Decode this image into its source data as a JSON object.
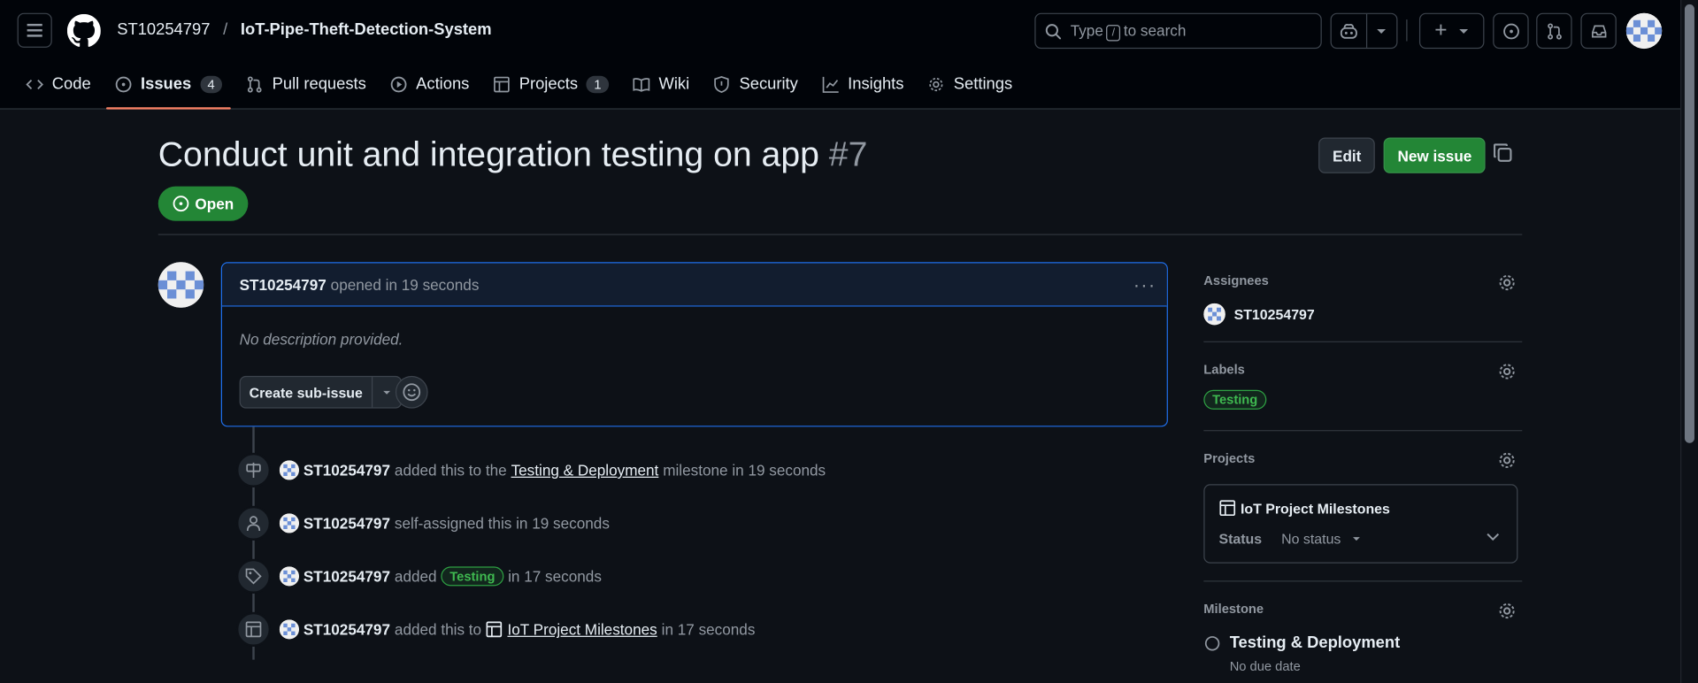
{
  "header": {
    "owner": "ST10254797",
    "separator": "/",
    "repo": "IoT-Pipe-Theft-Detection-System",
    "search_pre": "Type",
    "search_key": "/",
    "search_post": "to search"
  },
  "tabs": [
    {
      "label": "Code"
    },
    {
      "label": "Issues",
      "count": "4"
    },
    {
      "label": "Pull requests"
    },
    {
      "label": "Actions"
    },
    {
      "label": "Projects",
      "count": "1"
    },
    {
      "label": "Wiki"
    },
    {
      "label": "Security"
    },
    {
      "label": "Insights"
    },
    {
      "label": "Settings"
    }
  ],
  "issue": {
    "title": "Conduct unit and integration testing on app",
    "number": "#7",
    "state": "Open",
    "edit_label": "Edit",
    "new_label": "New issue"
  },
  "comment": {
    "author": "ST10254797",
    "meta": "opened in 19 seconds",
    "body": "No description provided.",
    "subissue_label": "Create sub-issue"
  },
  "timeline": {
    "e1": {
      "user": "ST10254797",
      "pre": "added this to the",
      "link": "Testing & Deployment",
      "post": "milestone in 19 seconds"
    },
    "e2": {
      "user": "ST10254797",
      "text": "self-assigned this in 19 seconds"
    },
    "e3": {
      "user": "ST10254797",
      "pre": "added",
      "label": "Testing",
      "post": "in 17 seconds"
    },
    "e4": {
      "user": "ST10254797",
      "pre": "added this to",
      "link": "IoT Project Milestones",
      "post": "in 17 seconds"
    }
  },
  "sidebar": {
    "assignees_title": "Assignees",
    "assignee": "ST10254797",
    "labels_title": "Labels",
    "label": "Testing",
    "projects_title": "Projects",
    "project_name": "IoT Project Milestones",
    "status_label": "Status",
    "status_value": "No status",
    "milestone_title": "Milestone",
    "milestone_name": "Testing & Deployment",
    "milestone_due": "No due date"
  },
  "colors": {
    "accent_green": "#238636",
    "tab_underline": "#f78166",
    "focus_blue": "#1f6feb",
    "label_green": "#3fb950"
  }
}
